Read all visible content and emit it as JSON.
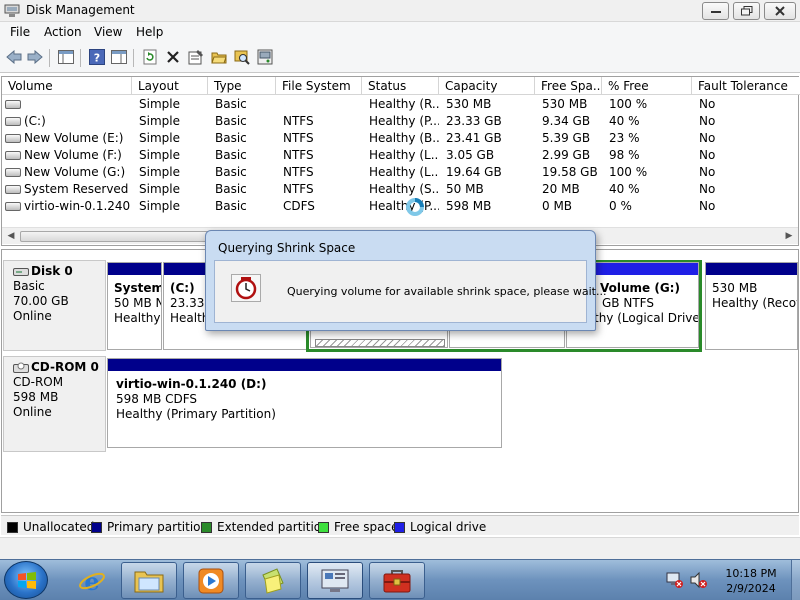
{
  "window": {
    "title": "Disk Management"
  },
  "menu": [
    "File",
    "Action",
    "View",
    "Help"
  ],
  "columns": [
    "Volume",
    "Layout",
    "Type",
    "File System",
    "Status",
    "Capacity",
    "Free Spa...",
    "% Free",
    "Fault Tolerance"
  ],
  "volumes": [
    {
      "volume": "",
      "layout": "Simple",
      "type": "Basic",
      "fs": "",
      "status": "Healthy (R...",
      "capacity": "530 MB",
      "free": "530 MB",
      "pct": "100 %",
      "fault": "No"
    },
    {
      "volume": "(C:)",
      "layout": "Simple",
      "type": "Basic",
      "fs": "NTFS",
      "status": "Healthy (P...",
      "capacity": "23.33 GB",
      "free": "9.34 GB",
      "pct": "40 %",
      "fault": "No"
    },
    {
      "volume": "New Volume (E:)",
      "layout": "Simple",
      "type": "Basic",
      "fs": "NTFS",
      "status": "Healthy (B...",
      "capacity": "23.41 GB",
      "free": "5.39 GB",
      "pct": "23 %",
      "fault": "No"
    },
    {
      "volume": "New Volume (F:)",
      "layout": "Simple",
      "type": "Basic",
      "fs": "NTFS",
      "status": "Healthy (L...",
      "capacity": "3.05 GB",
      "free": "2.99 GB",
      "pct": "98 %",
      "fault": "No"
    },
    {
      "volume": "New Volume (G:)",
      "layout": "Simple",
      "type": "Basic",
      "fs": "NTFS",
      "status": "Healthy (L...",
      "capacity": "19.64 GB",
      "free": "19.58 GB",
      "pct": "100 %",
      "fault": "No"
    },
    {
      "volume": "System Reserved",
      "layout": "Simple",
      "type": "Basic",
      "fs": "NTFS",
      "status": "Healthy (S...",
      "capacity": "50 MB",
      "free": "20 MB",
      "pct": "40 %",
      "fault": "No"
    },
    {
      "volume": "virtio-win-0.1.240 ...",
      "layout": "Simple",
      "type": "Basic",
      "fs": "CDFS",
      "status": "Healthy (P...",
      "capacity": "598 MB",
      "free": "0 MB",
      "pct": "0 %",
      "fault": "No"
    }
  ],
  "disks": [
    {
      "name": "Disk 0",
      "type": "Basic",
      "size": "70.00 GB",
      "state": "Online",
      "partitions": [
        {
          "line1": "System",
          "line2": "50 MB N",
          "line3": "Healthy"
        },
        {
          "line1": "(C:)",
          "line2": "23.33 G",
          "line3": "Health"
        },
        {
          "line1": "",
          "line2": "",
          "line3": ""
        },
        {
          "line1": "",
          "line2": "",
          "line3": ""
        },
        {
          "line1": "Volume  (G:)",
          "line2": "GB NTFS",
          "line3": "thy (Logical Drive)"
        },
        {
          "line1": "",
          "line2": "530 MB",
          "line3": "Healthy (Recov"
        }
      ]
    },
    {
      "name": "CD-ROM 0",
      "type": "CD-ROM",
      "size": "598 MB",
      "state": "Online",
      "partitions": [
        {
          "line1": "virtio-win-0.1.240  (D:)",
          "line2": "598 MB CDFS",
          "line3": "Healthy (Primary Partition)"
        }
      ]
    }
  ],
  "legend": [
    {
      "label": "Unallocated",
      "color": "#000000"
    },
    {
      "label": "Primary partition",
      "color": "#00008b"
    },
    {
      "label": "Extended partition",
      "color": "#2a8a2a"
    },
    {
      "label": "Free space",
      "color": "#3ee03e"
    },
    {
      "label": "Logical drive",
      "color": "#1f1fe6"
    }
  ],
  "dialog": {
    "title": "Querying Shrink Space",
    "message": "Querying volume for available shrink space, please wait..."
  },
  "clock": {
    "time": "10:18 PM",
    "date": "2/9/2024"
  },
  "colors": {
    "primary": "#00008b",
    "logical": "#1f1fe6",
    "extended": "#2a8a2a",
    "free": "#3ee03e"
  }
}
